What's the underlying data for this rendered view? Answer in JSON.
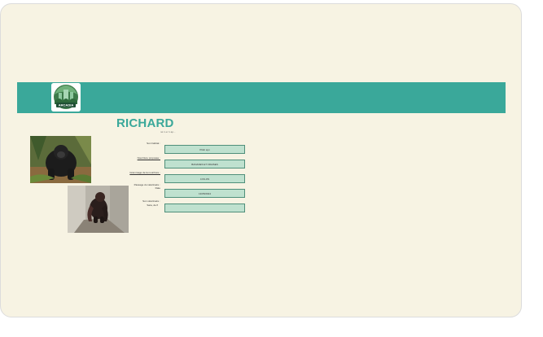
{
  "banner": {
    "logo_text": "ARCADIA",
    "accent_color": "#3aa89a"
  },
  "profile": {
    "name": "RICHARD",
    "subtitle": "né 1 er 1 ap..."
  },
  "photos": [
    {
      "icon": "gorilla-photo"
    },
    {
      "icon": "gorilla-photo"
    }
  ],
  "fields": [
    {
      "label": "Son habitat :",
      "value": "Pitsb ayn"
    },
    {
      "label": "Nourriture proposée :",
      "value": "BANANES ET FRAISES"
    },
    {
      "label": "Grammage de la nourriture :",
      "value": "4 KILOS"
    },
    {
      "label": "Passage du vétérinaire : Date",
      "value": "13/05/2024"
    },
    {
      "label": "Son vétérinaire :",
      "sublabel": "Sara, de fl",
      "value": ""
    }
  ],
  "colors": {
    "page": "#f7f3e3",
    "field_bg": "#bfe1cf",
    "field_border": "#4f8f7a"
  }
}
